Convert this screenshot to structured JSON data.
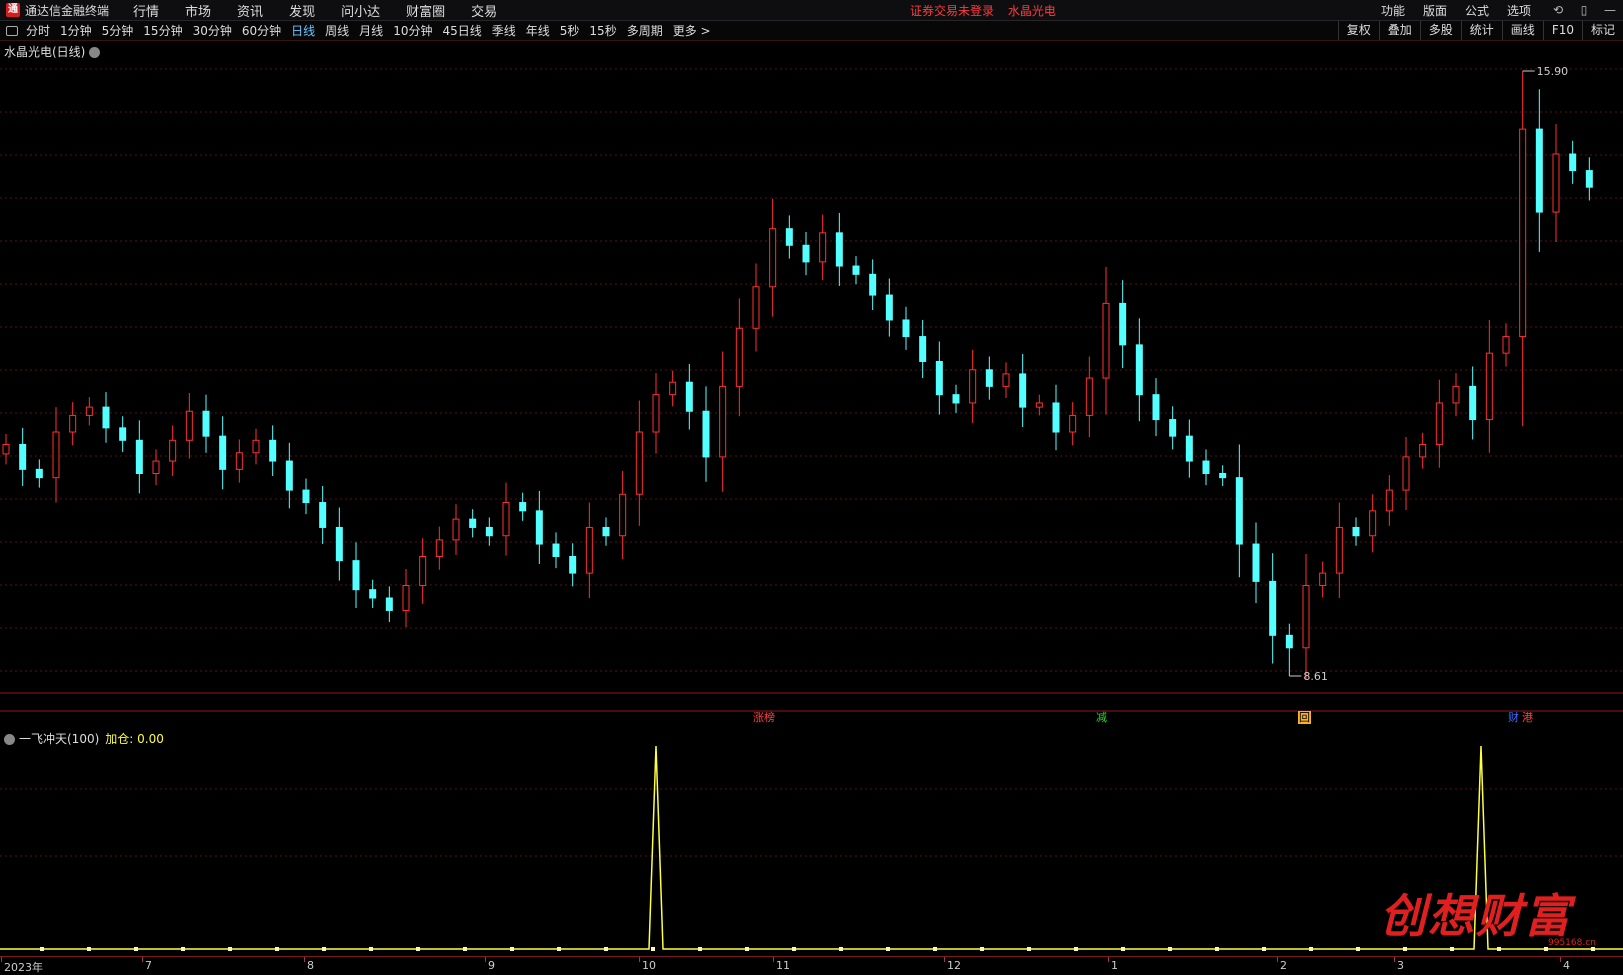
{
  "app": {
    "title": "通达信金融终端",
    "logo_icon": "tdx-logo-icon"
  },
  "menu": [
    "行情",
    "市场",
    "资讯",
    "发现",
    "问小达",
    "财富圈",
    "交易"
  ],
  "status": {
    "login": "证券交易未登录",
    "stock": "水晶光电"
  },
  "top_right": [
    "功能",
    "版面",
    "公式",
    "选项"
  ],
  "window_icons": [
    "refresh-icon",
    "phone-icon",
    "minimize-icon"
  ],
  "periods": [
    "分时",
    "1分钟",
    "5分钟",
    "15分钟",
    "30分钟",
    "60分钟",
    "日线",
    "周线",
    "月线",
    "10分钟",
    "45日线",
    "季线",
    "年线",
    "5秒",
    "15秒",
    "多周期",
    "更多 >"
  ],
  "active_period": "日线",
  "tools": [
    "复权",
    "叠加",
    "多股",
    "统计",
    "画线",
    "F10",
    "标记"
  ],
  "chart": {
    "stock_label": "水晶光电(日线)",
    "high_label": "15.90",
    "low_label": "8.61",
    "indicator_label": "一飞冲天(100)",
    "indicator_value_label": "加仓: 0.00",
    "events": [
      {
        "text": "涨榜",
        "kind": "red"
      },
      {
        "text": "减",
        "kind": "green"
      },
      {
        "text": "回",
        "kind": "orange"
      },
      {
        "text": "财",
        "kind": "blue"
      },
      {
        "text": "港",
        "kind": "red"
      }
    ],
    "x_labels": [
      "2023年",
      "7",
      "8",
      "9",
      "10",
      "11",
      "12",
      "1",
      "2",
      "3",
      "4"
    ],
    "watermark": "创想财富",
    "watermark_url": "995168.cn",
    "colors": {
      "up": "#ff3030",
      "down": "#54ffff",
      "grid": "#5a1010",
      "indicator": "#ffff40"
    }
  },
  "chart_data": {
    "type": "candlestick",
    "price_high": 15.9,
    "price_low": 8.61,
    "close_series": [
      11.4,
      11.1,
      11.0,
      11.55,
      11.75,
      11.85,
      11.6,
      11.45,
      11.05,
      11.2,
      11.45,
      11.8,
      11.5,
      11.1,
      11.3,
      11.45,
      11.2,
      10.85,
      10.7,
      10.4,
      10.0,
      9.65,
      9.55,
      9.4,
      9.7,
      10.05,
      10.25,
      10.5,
      10.4,
      10.3,
      10.7,
      10.6,
      10.2,
      10.05,
      9.85,
      10.4,
      10.3,
      10.8,
      11.55,
      12.0,
      12.15,
      11.8,
      11.25,
      12.1,
      12.8,
      13.3,
      14.0,
      13.8,
      13.6,
      13.95,
      13.55,
      13.45,
      13.2,
      12.9,
      12.7,
      12.4,
      12.0,
      11.9,
      12.3,
      12.1,
      12.25,
      11.85,
      11.9,
      11.55,
      11.75,
      12.2,
      13.1,
      12.6,
      12.0,
      11.7,
      11.5,
      11.2,
      11.05,
      11.0,
      10.2,
      9.75,
      9.1,
      8.95,
      9.7,
      9.85,
      10.4,
      10.3,
      10.6,
      10.85,
      11.25,
      11.4,
      11.9,
      12.1,
      11.7,
      12.5,
      12.7,
      15.2,
      14.2,
      14.9,
      14.7,
      14.5
    ],
    "events": [
      "涨榜",
      "减",
      "回",
      "财",
      "港"
    ],
    "indicator": {
      "name": "一飞冲天(100)",
      "signal_months": [
        "10",
        "3"
      ],
      "baseline": 0.0
    }
  }
}
